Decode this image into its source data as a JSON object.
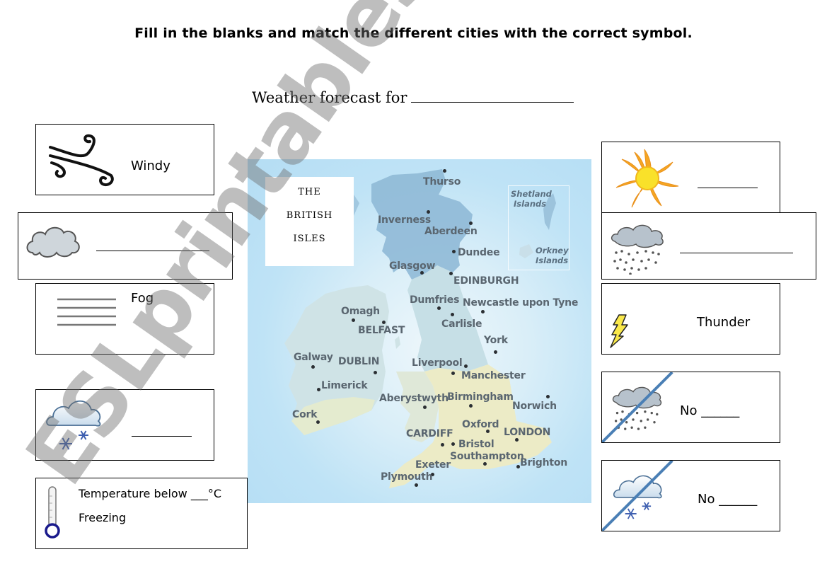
{
  "instruction": "Fill in the blanks and match the different cities with the correct symbol.",
  "forecast_title": "Weather forecast for",
  "left_cards": [
    {
      "icon": "wind-icon",
      "label": "Windy",
      "has_blank": false
    },
    {
      "icon": "cloud-icon",
      "label": "",
      "has_blank": true
    },
    {
      "icon": "fog-icon",
      "label": "Fog",
      "has_blank": false
    },
    {
      "icon": "snow-cloud-icon",
      "label": "",
      "has_blank": true
    },
    {
      "icon": "thermometer-icon",
      "line1": "Temperature below ___°C",
      "line2": "Freezing"
    }
  ],
  "right_cards": [
    {
      "icon": "sun-icon",
      "label": "",
      "has_blank": true
    },
    {
      "icon": "rain-cloud-icon",
      "label": "",
      "has_blank": true
    },
    {
      "icon": "lightning-icon",
      "label": "Thunder",
      "has_blank": false
    },
    {
      "icon": "rain-cloud-crossed-icon",
      "label": "No ______"
    },
    {
      "icon": "snow-cloud-crossed-icon",
      "label": "No ______"
    }
  ],
  "map": {
    "title_lines": [
      "THE",
      "BRITISH",
      "ISLES"
    ],
    "islands": [
      "Shetland Islands",
      "Orkney Islands"
    ],
    "cities": [
      "Thurso",
      "Inverness",
      "Aberdeen",
      "Dundee",
      "Glasgow",
      "EDINBURGH",
      "Dumfries",
      "Newcastle upon Tyne",
      "Carlisle",
      "Omagh",
      "BELFAST",
      "York",
      "Galway",
      "DUBLIN",
      "Liverpool",
      "Manchester",
      "Limerick",
      "Aberystwyth",
      "Birmingham",
      "Norwich",
      "Cork",
      "Oxford",
      "LONDON",
      "CARDIFF",
      "Bristol",
      "Southampton",
      "Exeter",
      "Brighton",
      "Plymouth"
    ]
  },
  "watermark": "ESLprintables.com",
  "colors": {
    "sea": "#b4ddf4",
    "scotland": "#8fb9d6",
    "ireland": "#cfe3e6",
    "england_south": "#ecebc6",
    "strike_line": "#4a7fb5",
    "sun": "#f5a623",
    "thermometer_bulb": "#1a1a8c"
  }
}
